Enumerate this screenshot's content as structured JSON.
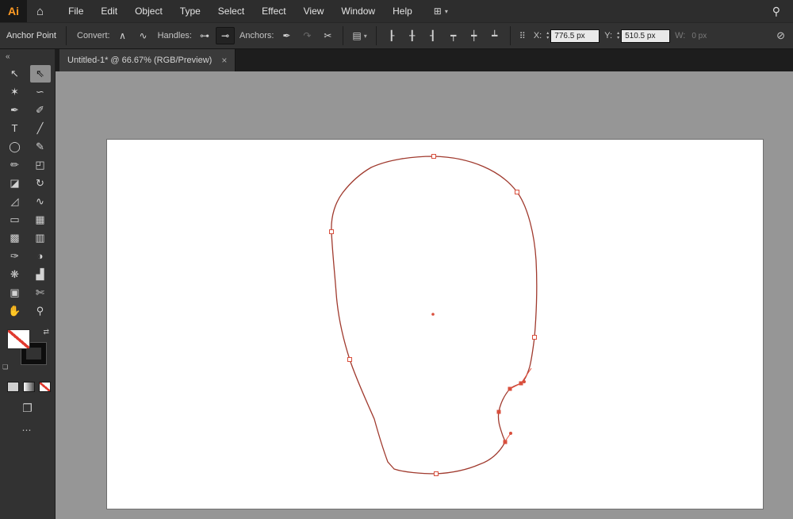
{
  "app": {
    "logo_text": "Ai",
    "home_glyph": "⌂",
    "workspace_glyph": "⊞",
    "caret_glyph": "▾",
    "search_glyph": "⚲",
    "menus": [
      {
        "name": "menu-file",
        "label": "File"
      },
      {
        "name": "menu-edit",
        "label": "Edit"
      },
      {
        "name": "menu-object",
        "label": "Object"
      },
      {
        "name": "menu-type",
        "label": "Type"
      },
      {
        "name": "menu-select",
        "label": "Select"
      },
      {
        "name": "menu-effect",
        "label": "Effect"
      },
      {
        "name": "menu-view",
        "label": "View"
      },
      {
        "name": "menu-window",
        "label": "Window"
      },
      {
        "name": "menu-help",
        "label": "Help"
      }
    ]
  },
  "controlbar": {
    "context_label": "Anchor Point",
    "convert_label": "Convert:",
    "convert_buttons": [
      {
        "name": "convert-to-corner-button",
        "glyph": "∧"
      },
      {
        "name": "convert-to-smooth-button",
        "glyph": "∿"
      }
    ],
    "handles_label": "Handles:",
    "handles_buttons": [
      {
        "name": "show-handles-button",
        "glyph": "⊶"
      },
      {
        "name": "hide-handles-button",
        "glyph": "⊸",
        "active": true
      }
    ],
    "anchors_label": "Anchors:",
    "anchors_buttons": [
      {
        "name": "remove-anchor-button",
        "glyph": "✒"
      },
      {
        "name": "connect-anchors-button",
        "glyph": "↷",
        "disabled": true
      },
      {
        "name": "cut-path-button",
        "glyph": "✂"
      }
    ],
    "widget_glyph": "▤",
    "widget_caret": "▾",
    "align_buttons": [
      {
        "name": "align-horizontal-left-button",
        "glyph": "┠"
      },
      {
        "name": "align-horizontal-center-button",
        "glyph": "╂"
      },
      {
        "name": "align-horizontal-right-button",
        "glyph": "┨"
      },
      {
        "name": "align-vertical-top-button",
        "glyph": "┯"
      },
      {
        "name": "align-vertical-center-button",
        "glyph": "┿"
      },
      {
        "name": "align-vertical-bottom-button",
        "glyph": "┷"
      }
    ],
    "ref_glyph": "⠿",
    "x_label": "X:",
    "x_value": "776.5 px",
    "y_label": "Y:",
    "y_value": "510.5 px",
    "w_label": "W:",
    "w_value": "0 px",
    "step_up": "▴",
    "step_down": "▾",
    "end_glyph": "⊘"
  },
  "tabbar": {
    "title": "Untitled-1* @ 66.67% (RGB/Preview)",
    "close_glyph": "×"
  },
  "toolbar": {
    "collapse_glyph": "«",
    "swap_glyph": "⇄",
    "mini_glyph": "❏",
    "screen_mode_glyph": "❐",
    "more_glyph": "⋯",
    "tools": [
      {
        "name": "selection-tool",
        "glyph": "↖"
      },
      {
        "name": "direct-selection-tool",
        "glyph": "⇖",
        "active": true
      },
      {
        "name": "magic-wand-tool",
        "glyph": "✶"
      },
      {
        "name": "lasso-tool",
        "glyph": "∽"
      },
      {
        "name": "pen-tool",
        "glyph": "✒"
      },
      {
        "name": "curvature-tool",
        "glyph": "✐"
      },
      {
        "name": "type-tool",
        "glyph": "T"
      },
      {
        "name": "line-segment-tool",
        "glyph": "╱"
      },
      {
        "name": "ellipse-tool",
        "glyph": "◯"
      },
      {
        "name": "paintbrush-tool",
        "glyph": "✎"
      },
      {
        "name": "pencil-tool",
        "glyph": "✏"
      },
      {
        "name": "shape-builder-tool",
        "glyph": "◰"
      },
      {
        "name": "eraser-tool",
        "glyph": "◪"
      },
      {
        "name": "rotate-tool",
        "glyph": "↻"
      },
      {
        "name": "scale-tool",
        "glyph": "◿"
      },
      {
        "name": "width-tool",
        "glyph": "∿"
      },
      {
        "name": "free-transform-tool",
        "glyph": "▭"
      },
      {
        "name": "perspective-grid-tool",
        "glyph": "▦"
      },
      {
        "name": "mesh-tool",
        "glyph": "▩"
      },
      {
        "name": "gradient-tool",
        "glyph": "▥"
      },
      {
        "name": "eyedropper-tool",
        "glyph": "✑"
      },
      {
        "name": "blend-tool",
        "glyph": "◑"
      },
      {
        "name": "symbol-sprayer-tool",
        "glyph": "❋"
      },
      {
        "name": "column-graph-tool",
        "glyph": "▟"
      },
      {
        "name": "artboard-tool",
        "glyph": "▣"
      },
      {
        "name": "slice-tool",
        "glyph": "✄"
      },
      {
        "name": "hand-tool",
        "glyph": "✋"
      },
      {
        "name": "zoom-tool",
        "glyph": "⚲"
      }
    ]
  },
  "canvas": {
    "colors": {
      "background": "#969696",
      "artboard": "#ffffff",
      "path_stroke": "#a03a2e",
      "anchor_stroke": "#d94f3d",
      "selected_anchor": "#d94f3d"
    }
  }
}
